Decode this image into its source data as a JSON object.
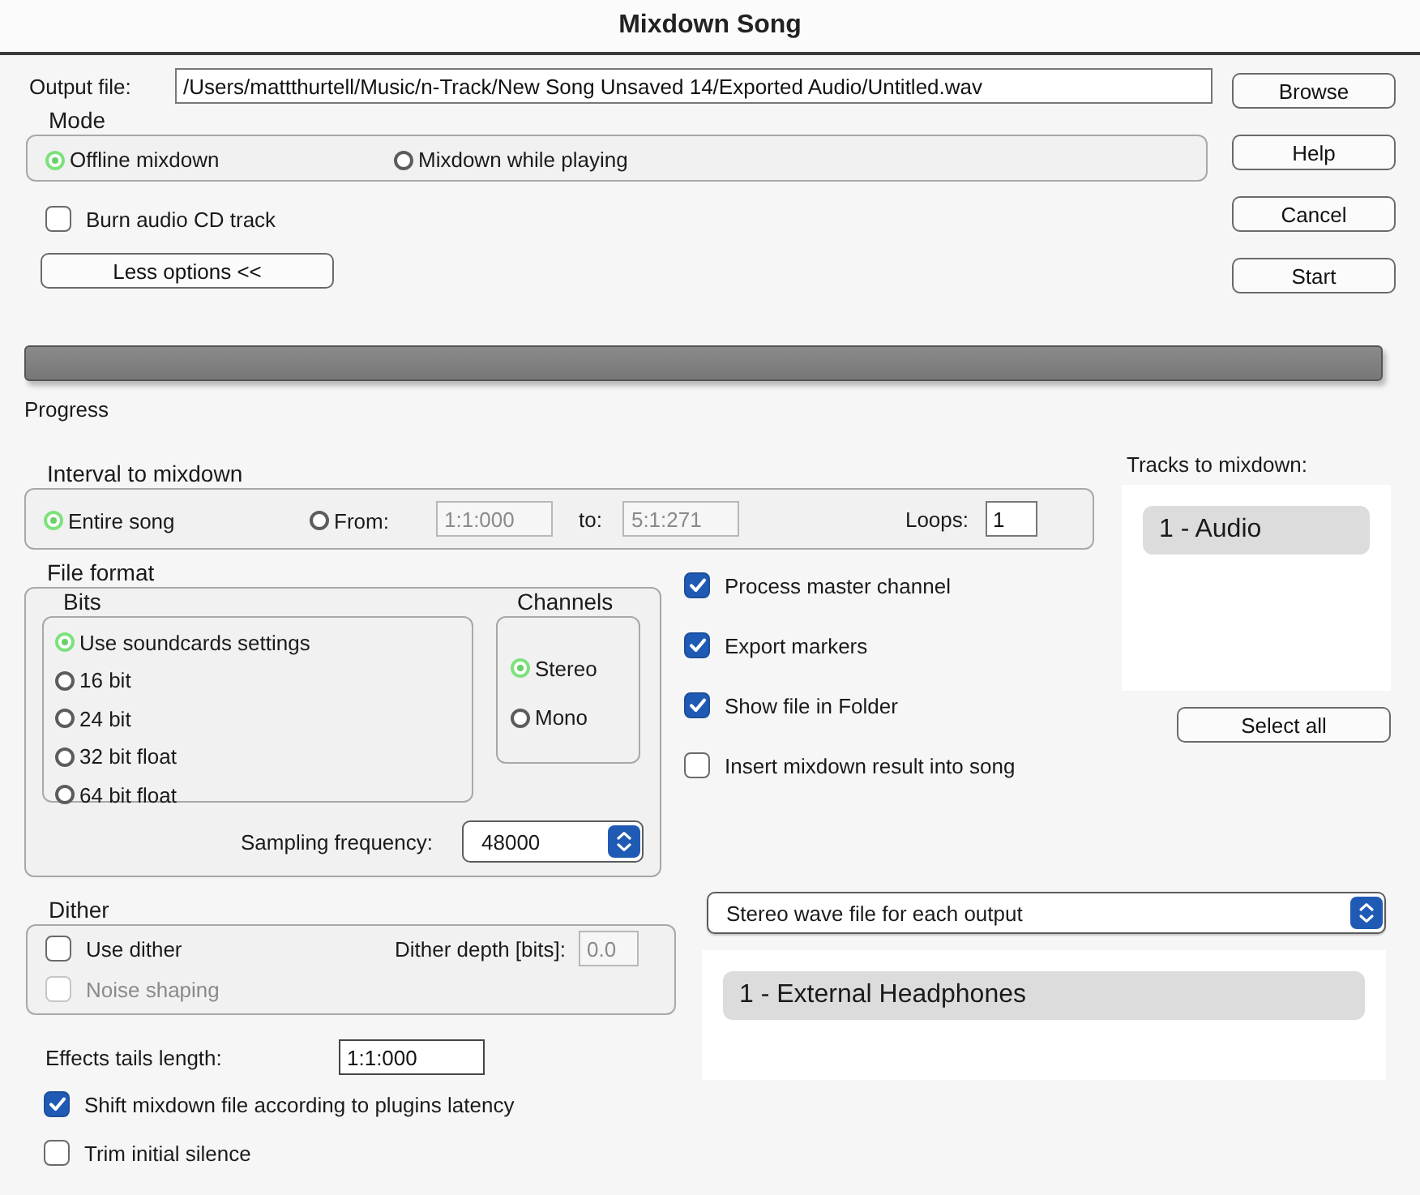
{
  "window": {
    "title": "Mixdown Song"
  },
  "output_file": {
    "label": "Output file:",
    "value": "/Users/mattthurtell/Music/n-Track/New Song Unsaved 14/Exported Audio/Untitled.wav"
  },
  "mode": {
    "label": "Mode",
    "options": [
      {
        "label": "Offline mixdown",
        "selected": true
      },
      {
        "label": "Mixdown while playing",
        "selected": false
      }
    ]
  },
  "burn_cd": {
    "label": "Burn audio CD track",
    "checked": false
  },
  "less_options_button": "Less options <<",
  "buttons": [
    "Browse",
    "Help",
    "Cancel",
    "Start"
  ],
  "progress": {
    "label": "Progress",
    "level": 0
  },
  "interval": {
    "label": "Interval to mixdown",
    "options": [
      {
        "label": "Entire song",
        "selected": true
      },
      {
        "label": "From:",
        "selected": false
      }
    ],
    "from": {
      "value": "1:1:000",
      "disabled": true
    },
    "to_label": "to:",
    "to": {
      "value": "5:1:271",
      "disabled": true
    },
    "loops_label": "Loops:",
    "loops": "1"
  },
  "file_format": {
    "label": "File format",
    "bits": {
      "label": "Bits",
      "options": [
        {
          "label": "Use soundcards settings",
          "selected": true
        },
        {
          "label": "16 bit",
          "selected": false
        },
        {
          "label": "24 bit",
          "selected": false
        },
        {
          "label": "32 bit float",
          "selected": false
        },
        {
          "label": "64 bit float",
          "selected": false
        }
      ]
    },
    "channels": {
      "label": "Channels",
      "options": [
        {
          "label": "Stereo",
          "selected": true
        },
        {
          "label": "Mono",
          "selected": false
        }
      ]
    },
    "sampling": {
      "label": "Sampling frequency:",
      "value": "48000"
    }
  },
  "options": [
    {
      "label": "Process master channel",
      "checked": true
    },
    {
      "label": "Export markers",
      "checked": true
    },
    {
      "label": "Show file in Folder",
      "checked": true
    },
    {
      "label": "Insert mixdown result into song",
      "checked": false
    }
  ],
  "tracks": {
    "label": "Tracks to mixdown:",
    "items": [
      {
        "label": "1 - Audio",
        "selected": true
      }
    ],
    "select_all": "Select all"
  },
  "dither": {
    "label": "Dither",
    "use": {
      "label": "Use dither",
      "checked": false
    },
    "noise_shaping": {
      "label": "Noise shaping",
      "checked": false,
      "disabled": true
    },
    "depth_label": "Dither depth [bits]:",
    "depth": {
      "value": "0.0",
      "disabled": true
    }
  },
  "effects_tails": {
    "label": "Effects tails length:",
    "value": "1:1:000"
  },
  "bottom_options": [
    {
      "label": "Shift mixdown file according to plugins latency",
      "checked": true
    },
    {
      "label": "Trim initial silence",
      "checked": false
    }
  ],
  "output_mode": {
    "value": "Stereo wave file for each output"
  },
  "outputs": [
    {
      "label": "1 - External Headphones",
      "selected": true
    }
  ]
}
